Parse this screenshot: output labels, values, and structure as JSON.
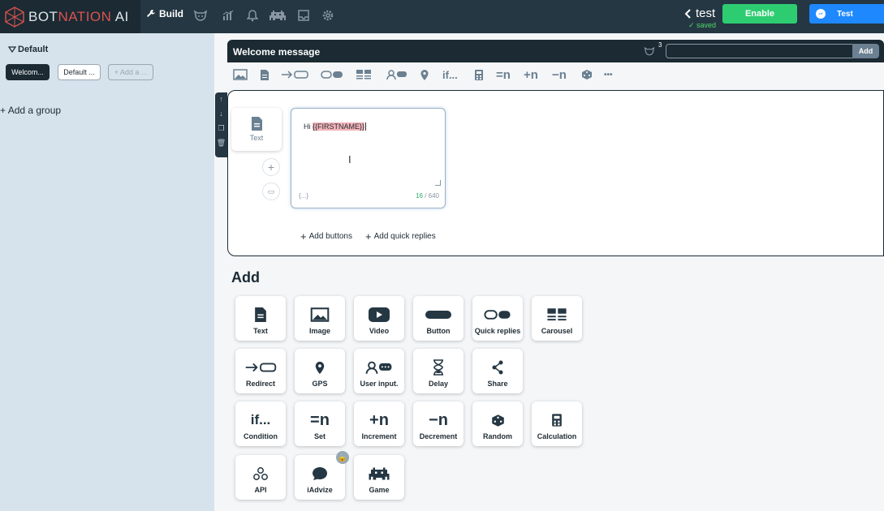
{
  "brand": {
    "prefix": "BOT",
    "highlight": "NATION",
    "suffix": " AI"
  },
  "nav": {
    "build_label": "Build",
    "icons": [
      "bot-icon",
      "stats-icon",
      "bell-icon",
      "invader-icon",
      "inbox-icon",
      "settings-icon"
    ]
  },
  "bot": {
    "name": "test",
    "status": "saved"
  },
  "actions": {
    "enable_label": "Enable",
    "test_label": "Test"
  },
  "sidebar": {
    "group_name": "Default",
    "chips": [
      "Welcom...",
      "Default ...",
      "+ Add a ..."
    ],
    "add_group_label": "Add a group"
  },
  "message": {
    "title": "Welcome message",
    "badge_count": "3",
    "add_label": "Add"
  },
  "toolbar": {
    "if_label": "if...",
    "set_label": "=n",
    "increment_label": "+n",
    "decrement_label": "−n",
    "more_label": "•••"
  },
  "editor": {
    "card_label": "Text",
    "text_prefix": "Hi ",
    "text_variable": "{{FIRSTNAME}}",
    "variables_label": "{...}",
    "char_count": "16",
    "char_limit": " / 640",
    "add_buttons_label": "Add buttons",
    "add_quick_replies_label": "Add quick replies"
  },
  "add_section": {
    "title": "Add",
    "tiles": [
      {
        "label": "Text",
        "icon": "document-icon"
      },
      {
        "label": "Image",
        "icon": "image-icon"
      },
      {
        "label": "Video",
        "icon": "video-icon"
      },
      {
        "label": "Button",
        "icon": "button-icon"
      },
      {
        "label": "Quick replies",
        "icon": "quick-replies-icon"
      },
      {
        "label": "Carousel",
        "icon": "carousel-icon"
      },
      {
        "label": "Redirect",
        "icon": "redirect-icon"
      },
      {
        "label": "GPS",
        "icon": "location-pin-icon"
      },
      {
        "label": "User input.",
        "icon": "user-input-icon"
      },
      {
        "label": "Delay",
        "icon": "hourglass-icon"
      },
      {
        "label": "Share",
        "icon": "share-icon"
      },
      {
        "label": "Condition",
        "icon": "condition-icon",
        "glyph": "if..."
      },
      {
        "label": "Set",
        "icon": "set-icon",
        "glyph": "=n"
      },
      {
        "label": "Increment",
        "icon": "increment-icon",
        "glyph": "+n"
      },
      {
        "label": "Decrement",
        "icon": "decrement-icon",
        "glyph": "−n"
      },
      {
        "label": "Random",
        "icon": "dice-icon"
      },
      {
        "label": "Calculation",
        "icon": "calculator-icon"
      },
      {
        "label": "API",
        "icon": "api-icon"
      },
      {
        "label": "iAdvize",
        "icon": "chat-bubble-icon"
      },
      {
        "label": "Game",
        "icon": "game-icon"
      }
    ]
  },
  "colors": {
    "topbar": "#253743",
    "sidebar": "#d6e3ec",
    "enable": "#2ecc71",
    "test": "#1e88ff",
    "accent_dark": "#1b2a33"
  }
}
